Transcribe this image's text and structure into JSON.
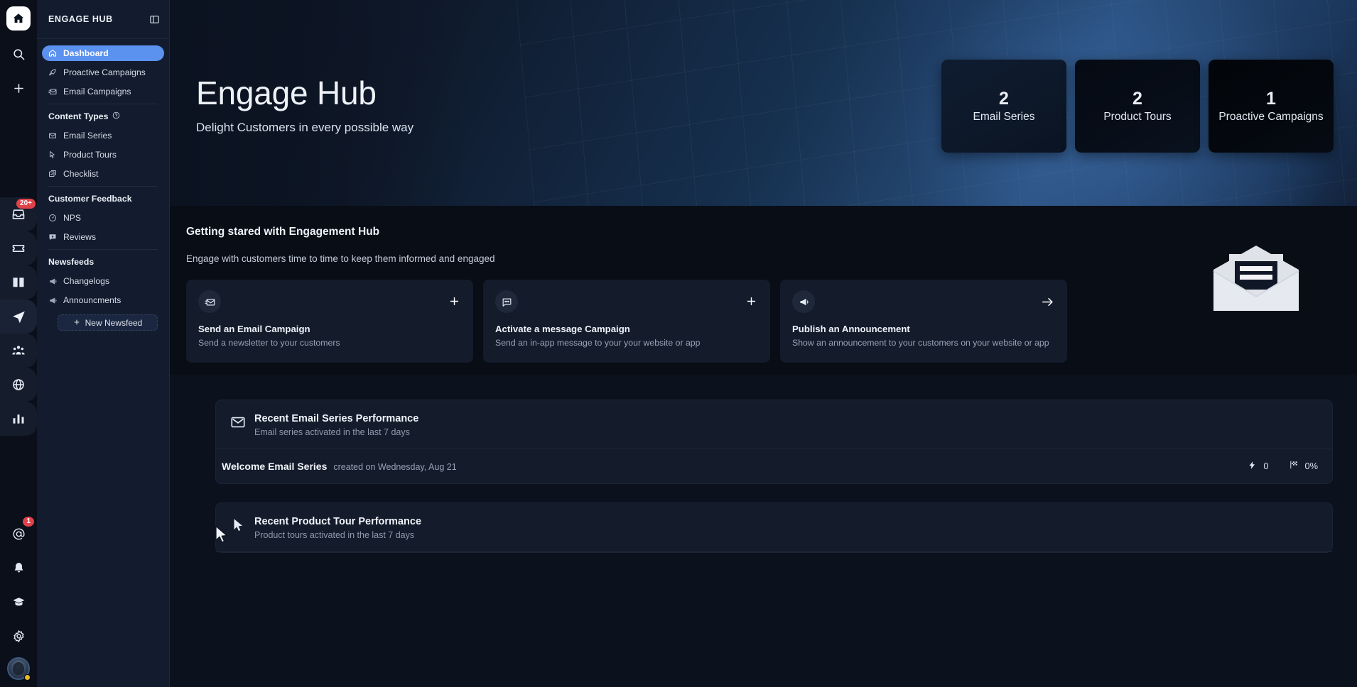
{
  "rail": {
    "home_icon": "home-icon",
    "items": [
      {
        "name": "search-icon"
      },
      {
        "name": "plus-icon"
      },
      {
        "name": "inbox-icon",
        "badge": "20+"
      },
      {
        "name": "ticket-icon"
      },
      {
        "name": "book-icon"
      },
      {
        "name": "send-icon"
      },
      {
        "name": "people-icon"
      },
      {
        "name": "globe-icon"
      },
      {
        "name": "analytics-icon"
      }
    ],
    "bottom": [
      {
        "name": "mention-icon",
        "badge": "1"
      },
      {
        "name": "bell-icon"
      },
      {
        "name": "graduation-cap-icon"
      },
      {
        "name": "gear-icon"
      }
    ]
  },
  "sidebar": {
    "title": "ENGAGE HUB",
    "collapse_icon": "panel-collapse-icon",
    "nav": [
      {
        "label": "Dashboard",
        "icon": "home-icon",
        "active": true
      },
      {
        "label": "Proactive Campaigns",
        "icon": "rocket-icon",
        "active": false
      },
      {
        "label": "Email Campaigns",
        "icon": "mail-send-icon",
        "active": false
      }
    ],
    "groups": [
      {
        "title": "Content Types",
        "has_help": true,
        "items": [
          {
            "label": "Email Series",
            "icon": "mail-open-icon"
          },
          {
            "label": "Product Tours",
            "icon": "cursor-icon"
          },
          {
            "label": "Checklist",
            "icon": "checklist-icon"
          }
        ]
      },
      {
        "title": "Customer Feedback",
        "has_help": false,
        "items": [
          {
            "label": "NPS",
            "icon": "gauge-icon"
          },
          {
            "label": "Reviews",
            "icon": "review-icon"
          }
        ]
      },
      {
        "title": "Newsfeeds",
        "has_help": false,
        "items": [
          {
            "label": "Changelogs",
            "icon": "megaphone-icon"
          },
          {
            "label": "Announcments",
            "icon": "megaphone-icon"
          }
        ]
      }
    ],
    "new_newsfeed": "New Newsfeed"
  },
  "hero": {
    "title": "Engage Hub",
    "subtitle": "Delight Customers in every possible way",
    "stats": [
      {
        "value": "2",
        "label": "Email Series"
      },
      {
        "value": "2",
        "label": "Product Tours"
      },
      {
        "value": "1",
        "label": "Proactive Campaigns"
      }
    ]
  },
  "getting_started": {
    "heading": "Getting stared with Engagement Hub",
    "subheading": "Engage with customers time to time to keep them informed and engaged",
    "cards": [
      {
        "icon": "mail-send-icon",
        "action_icon": "plus-icon",
        "title": "Send an Email Campaign",
        "description": "Send a newsletter to your customers"
      },
      {
        "icon": "chat-icon",
        "action_icon": "plus-icon",
        "title": "Activate a message Campaign",
        "description": "Send an in-app message to your your website or app"
      },
      {
        "icon": "megaphone-icon",
        "action_icon": "arrow-right-icon",
        "title": "Publish an Announcement",
        "description": "Show an announcement to your customers on your website or app"
      }
    ],
    "illustration": "open-envelope-illustration"
  },
  "panels": [
    {
      "icon": "mail-icon",
      "title": "Recent Email Series Performance",
      "description": "Email series activated in the last 7 days",
      "row": {
        "name": "Welcome Email Series",
        "meta": "created on Wednesday, Aug 21",
        "stats": [
          {
            "icon": "bolt-icon",
            "value": "0"
          },
          {
            "icon": "flag-icon",
            "value": "0%"
          }
        ]
      }
    },
    {
      "icon": "cursor-icon",
      "title": "Recent Product Tour Performance",
      "description": "Product tours activated in the last 7 days"
    }
  ],
  "colors": {
    "accent": "#5b91ef",
    "badge_red": "#e0424a",
    "status_yellow": "#e8b923",
    "sidebar_bg": "#131c2e",
    "rail_bg": "#0b0f1a",
    "main_bg": "#0c121d",
    "panel_bg": "#141c2c"
  }
}
